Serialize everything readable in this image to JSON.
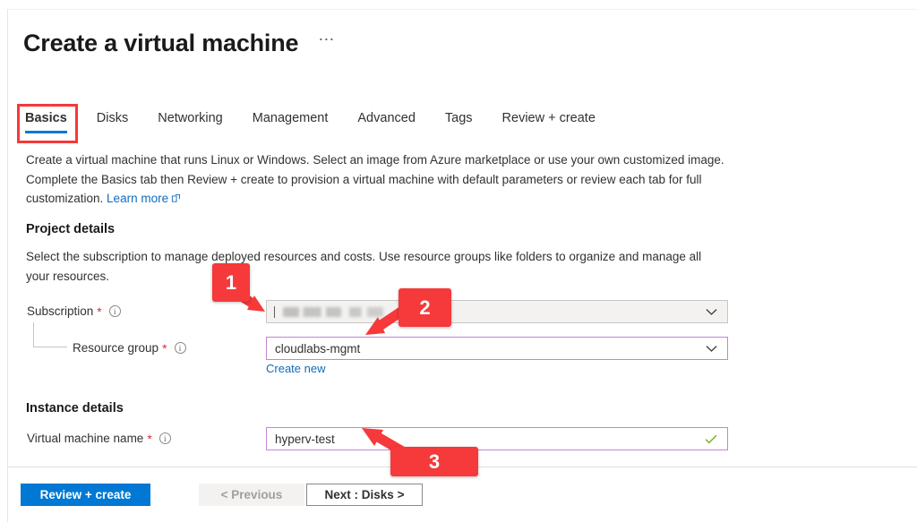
{
  "header": {
    "title": "Create a virtual machine",
    "more_label": "⋯"
  },
  "tabs": [
    {
      "label": "Basics",
      "active": true
    },
    {
      "label": "Disks",
      "active": false
    },
    {
      "label": "Networking",
      "active": false
    },
    {
      "label": "Management",
      "active": false
    },
    {
      "label": "Advanced",
      "active": false
    },
    {
      "label": "Tags",
      "active": false
    },
    {
      "label": "Review + create",
      "active": false
    }
  ],
  "description": {
    "text": "Create a virtual machine that runs Linux or Windows. Select an image from Azure marketplace or use your own customized image. Complete the Basics tab then Review + create to provision a virtual machine with default parameters or review each tab for full customization. ",
    "link_label": "Learn more"
  },
  "project_details": {
    "heading": "Project details",
    "description": "Select the subscription to manage deployed resources and costs. Use resource groups like folders to organize and manage all your resources.",
    "subscription": {
      "label": "Subscription",
      "required_mark": "*",
      "value": "",
      "redacted": true
    },
    "resource_group": {
      "label": "Resource group",
      "required_mark": "*",
      "value": "cloudlabs-mgmt",
      "create_new_label": "Create new"
    }
  },
  "instance_details": {
    "heading": "Instance details",
    "vm_name": {
      "label": "Virtual machine name",
      "required_mark": "*",
      "value": "hyperv-test",
      "valid": true
    }
  },
  "footer": {
    "review_create_label": "Review + create",
    "previous_label": "< Previous",
    "next_label": "Next : Disks >"
  },
  "annotations": [
    {
      "number": "1",
      "target": "subscription-field"
    },
    {
      "number": "2",
      "target": "resource-group-field"
    },
    {
      "number": "3",
      "target": "vm-name-field"
    }
  ],
  "colors": {
    "accent_blue": "#0078d4",
    "link_blue": "#0f6cbd",
    "annotation_red": "#f6393a",
    "required_red": "#d13438",
    "focus_purple": "#c286d4",
    "valid_green": "#7bb432"
  }
}
